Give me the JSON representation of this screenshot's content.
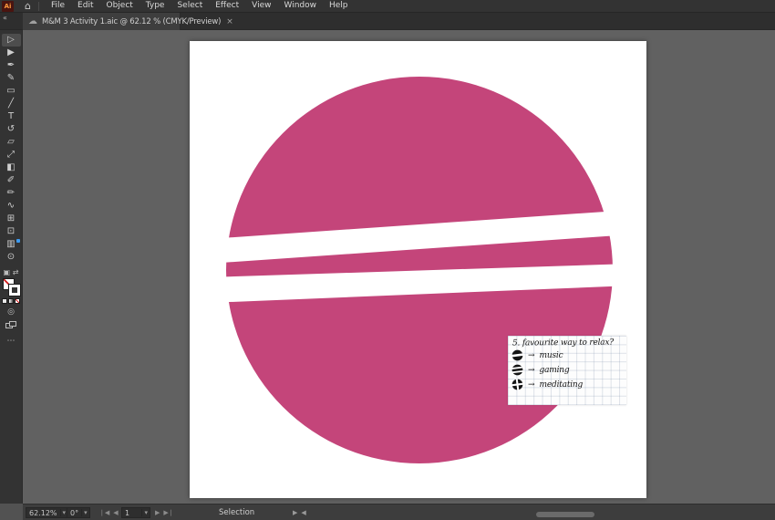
{
  "app": {
    "title": "Adobe Illustrator"
  },
  "menu_bar": {
    "logo_text": "Ai",
    "home_icon": "⌂",
    "items": [
      "File",
      "Edit",
      "Object",
      "Type",
      "Select",
      "Effect",
      "View",
      "Window",
      "Help"
    ]
  },
  "tab_bar": {
    "collapse_icon": "«",
    "tab": {
      "cloud_icon": "☁",
      "title": "M&M 3 Activity 1.aic @ 62.12 % (CMYK/Preview)",
      "close_icon": "×"
    }
  },
  "toolbar": {
    "tools": [
      {
        "name": "selection",
        "glyph": "▷"
      },
      {
        "name": "direct-selection",
        "glyph": "▶"
      },
      {
        "name": "pen",
        "glyph": "✒"
      },
      {
        "name": "curvature",
        "glyph": "✎"
      },
      {
        "name": "rectangle",
        "glyph": "▭"
      },
      {
        "name": "line-segment",
        "glyph": "╱"
      },
      {
        "name": "type",
        "glyph": "T"
      },
      {
        "name": "rotate",
        "glyph": "↺"
      },
      {
        "name": "eraser",
        "glyph": "▱"
      },
      {
        "name": "scale",
        "glyph": "⤢"
      },
      {
        "name": "gradient",
        "glyph": "◧"
      },
      {
        "name": "paintbrush",
        "glyph": "✐"
      },
      {
        "name": "pencil",
        "glyph": "✏"
      },
      {
        "name": "shaper",
        "glyph": "∿"
      },
      {
        "name": "shape-builder",
        "glyph": "⊞"
      },
      {
        "name": "artboard",
        "glyph": "⊡"
      },
      {
        "name": "column-graph",
        "glyph": "▥"
      },
      {
        "name": "zoom",
        "glyph": "⊙"
      }
    ],
    "swap_icon": "⇄",
    "default_swatch_icon": "▣",
    "draw_mode_icon": "◎",
    "more_icon": "⋯"
  },
  "canvas": {
    "artwork_fill": "#c4457a",
    "artboard_bg": "#ffffff"
  },
  "note": {
    "title": "5. favourite way to relax?",
    "arrow": "→",
    "items": [
      {
        "icon": "circle-one-stripe",
        "label": "music"
      },
      {
        "icon": "circle-two-stripes",
        "label": "gaming"
      },
      {
        "icon": "circle-quarters",
        "label": "meditating"
      }
    ]
  },
  "status_bar": {
    "zoom_level": "62.12%",
    "rotation": "0°",
    "artboard_number": "1",
    "status": "Selection",
    "icons": {
      "dropdown": "▾",
      "first": "❘◀",
      "prev": "◀",
      "next": "▶",
      "last": "▶❘",
      "expand": "▶",
      "collapse": "◀"
    }
  }
}
